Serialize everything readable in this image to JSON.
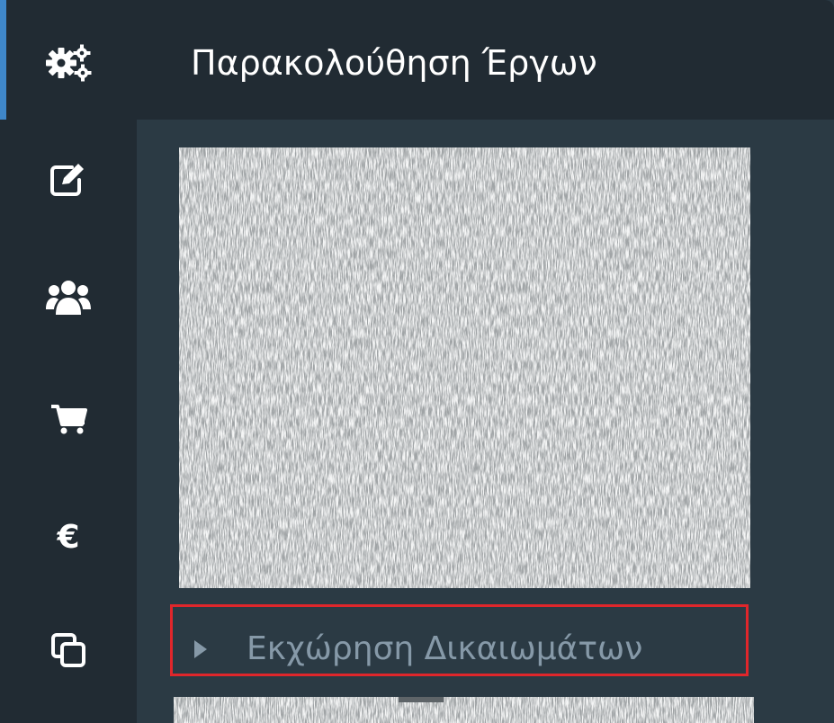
{
  "header": {
    "title": "Παρακολούθηση Έργων",
    "icon": "gears-icon"
  },
  "sidebar": {
    "items": [
      {
        "icon": "edit-icon"
      },
      {
        "icon": "users-icon"
      },
      {
        "icon": "cart-icon"
      },
      {
        "icon": "euro-icon",
        "glyph": "€"
      },
      {
        "icon": "copy-icon"
      }
    ]
  },
  "content": {
    "permission_row": {
      "label": "Εκχώρηση Δικαιωμάτων",
      "highlight_color": "#e0262b"
    }
  },
  "colors": {
    "sidebar_bg": "#212b33",
    "content_bg": "#2b3a44",
    "accent": "#3f87c9",
    "muted_text": "#8699a8"
  }
}
